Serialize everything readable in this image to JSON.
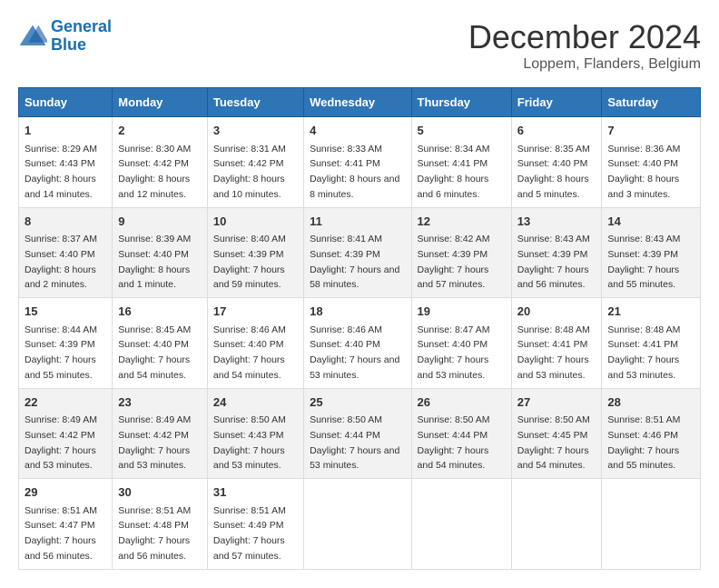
{
  "logo": {
    "line1": "General",
    "line2": "Blue"
  },
  "title": "December 2024",
  "subtitle": "Loppem, Flanders, Belgium",
  "days_of_week": [
    "Sunday",
    "Monday",
    "Tuesday",
    "Wednesday",
    "Thursday",
    "Friday",
    "Saturday"
  ],
  "weeks": [
    [
      {
        "day": "1",
        "sunrise": "8:29 AM",
        "sunset": "4:43 PM",
        "daylight": "8 hours and 14 minutes."
      },
      {
        "day": "2",
        "sunrise": "8:30 AM",
        "sunset": "4:42 PM",
        "daylight": "8 hours and 12 minutes."
      },
      {
        "day": "3",
        "sunrise": "8:31 AM",
        "sunset": "4:42 PM",
        "daylight": "8 hours and 10 minutes."
      },
      {
        "day": "4",
        "sunrise": "8:33 AM",
        "sunset": "4:41 PM",
        "daylight": "8 hours and 8 minutes."
      },
      {
        "day": "5",
        "sunrise": "8:34 AM",
        "sunset": "4:41 PM",
        "daylight": "8 hours and 6 minutes."
      },
      {
        "day": "6",
        "sunrise": "8:35 AM",
        "sunset": "4:40 PM",
        "daylight": "8 hours and 5 minutes."
      },
      {
        "day": "7",
        "sunrise": "8:36 AM",
        "sunset": "4:40 PM",
        "daylight": "8 hours and 3 minutes."
      }
    ],
    [
      {
        "day": "8",
        "sunrise": "8:37 AM",
        "sunset": "4:40 PM",
        "daylight": "8 hours and 2 minutes."
      },
      {
        "day": "9",
        "sunrise": "8:39 AM",
        "sunset": "4:40 PM",
        "daylight": "8 hours and 1 minute."
      },
      {
        "day": "10",
        "sunrise": "8:40 AM",
        "sunset": "4:39 PM",
        "daylight": "7 hours and 59 minutes."
      },
      {
        "day": "11",
        "sunrise": "8:41 AM",
        "sunset": "4:39 PM",
        "daylight": "7 hours and 58 minutes."
      },
      {
        "day": "12",
        "sunrise": "8:42 AM",
        "sunset": "4:39 PM",
        "daylight": "7 hours and 57 minutes."
      },
      {
        "day": "13",
        "sunrise": "8:43 AM",
        "sunset": "4:39 PM",
        "daylight": "7 hours and 56 minutes."
      },
      {
        "day": "14",
        "sunrise": "8:43 AM",
        "sunset": "4:39 PM",
        "daylight": "7 hours and 55 minutes."
      }
    ],
    [
      {
        "day": "15",
        "sunrise": "8:44 AM",
        "sunset": "4:39 PM",
        "daylight": "7 hours and 55 minutes."
      },
      {
        "day": "16",
        "sunrise": "8:45 AM",
        "sunset": "4:40 PM",
        "daylight": "7 hours and 54 minutes."
      },
      {
        "day": "17",
        "sunrise": "8:46 AM",
        "sunset": "4:40 PM",
        "daylight": "7 hours and 54 minutes."
      },
      {
        "day": "18",
        "sunrise": "8:46 AM",
        "sunset": "4:40 PM",
        "daylight": "7 hours and 53 minutes."
      },
      {
        "day": "19",
        "sunrise": "8:47 AM",
        "sunset": "4:40 PM",
        "daylight": "7 hours and 53 minutes."
      },
      {
        "day": "20",
        "sunrise": "8:48 AM",
        "sunset": "4:41 PM",
        "daylight": "7 hours and 53 minutes."
      },
      {
        "day": "21",
        "sunrise": "8:48 AM",
        "sunset": "4:41 PM",
        "daylight": "7 hours and 53 minutes."
      }
    ],
    [
      {
        "day": "22",
        "sunrise": "8:49 AM",
        "sunset": "4:42 PM",
        "daylight": "7 hours and 53 minutes."
      },
      {
        "day": "23",
        "sunrise": "8:49 AM",
        "sunset": "4:42 PM",
        "daylight": "7 hours and 53 minutes."
      },
      {
        "day": "24",
        "sunrise": "8:50 AM",
        "sunset": "4:43 PM",
        "daylight": "7 hours and 53 minutes."
      },
      {
        "day": "25",
        "sunrise": "8:50 AM",
        "sunset": "4:44 PM",
        "daylight": "7 hours and 53 minutes."
      },
      {
        "day": "26",
        "sunrise": "8:50 AM",
        "sunset": "4:44 PM",
        "daylight": "7 hours and 54 minutes."
      },
      {
        "day": "27",
        "sunrise": "8:50 AM",
        "sunset": "4:45 PM",
        "daylight": "7 hours and 54 minutes."
      },
      {
        "day": "28",
        "sunrise": "8:51 AM",
        "sunset": "4:46 PM",
        "daylight": "7 hours and 55 minutes."
      }
    ],
    [
      {
        "day": "29",
        "sunrise": "8:51 AM",
        "sunset": "4:47 PM",
        "daylight": "7 hours and 56 minutes."
      },
      {
        "day": "30",
        "sunrise": "8:51 AM",
        "sunset": "4:48 PM",
        "daylight": "7 hours and 56 minutes."
      },
      {
        "day": "31",
        "sunrise": "8:51 AM",
        "sunset": "4:49 PM",
        "daylight": "7 hours and 57 minutes."
      },
      null,
      null,
      null,
      null
    ]
  ],
  "labels": {
    "sunrise": "Sunrise:",
    "sunset": "Sunset:",
    "daylight": "Daylight:"
  }
}
